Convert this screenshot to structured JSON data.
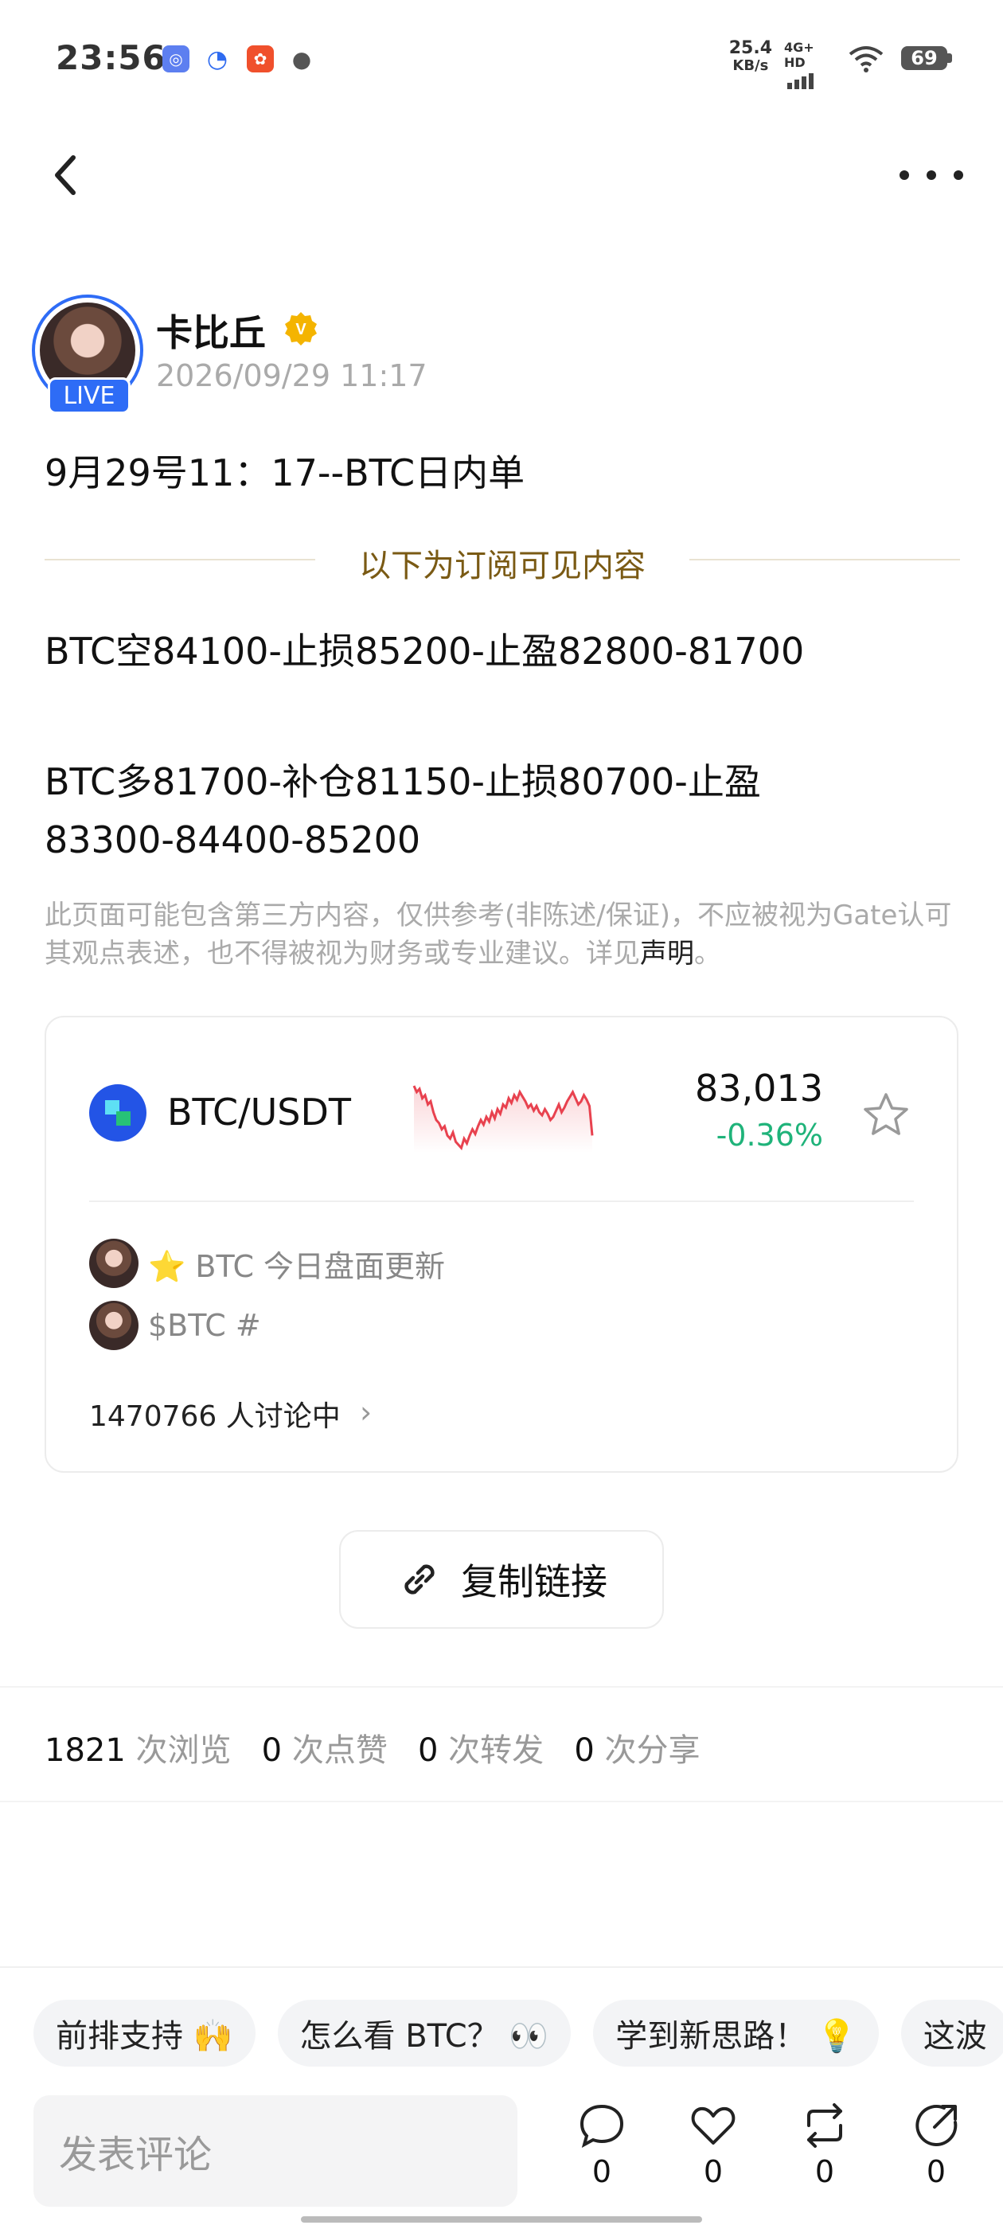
{
  "status_bar": {
    "time": "23:56",
    "net_speed_value": "25.4",
    "net_speed_unit": "KB/s",
    "network": "4G+ HD",
    "battery": "69"
  },
  "author": {
    "name": "卡比丘",
    "live_label": "LIVE",
    "timestamp": "2026/09/29 11:17"
  },
  "post": {
    "title": "9月29号11：17--BTC日内单",
    "subscribe_divider": "以下为订阅可见内容",
    "lines": [
      "BTC空84100-止损85200-止盈82800-81700",
      "BTC多81700-补仓81150-止损80700-止盈",
      "83300-84400-85200"
    ],
    "disclaimer_text": "此页面可能包含第三方内容，仅供参考(非陈述/保证)，不应被视为Gate认可其观点表述，也不得被视为财务或专业建议。详见",
    "disclaimer_link": "声明",
    "disclaimer_end": "。"
  },
  "market_card": {
    "pair": "BTC/USDT",
    "price": "83,013",
    "change": "-0.36%",
    "topics": [
      "⭐ BTC 今日盘面更新",
      "$BTC #"
    ],
    "discussion": "1470766 人讨论中",
    "sparkline": [
      52,
      48,
      50,
      44,
      46,
      40,
      42,
      35,
      30,
      28,
      24,
      26,
      20,
      18,
      22,
      16,
      14,
      12,
      18,
      15,
      20,
      24,
      21,
      26,
      30,
      27,
      32,
      29,
      35,
      31,
      37,
      34,
      40,
      38,
      44,
      41,
      46,
      43,
      48,
      45,
      42,
      38,
      40,
      36,
      39,
      35,
      33,
      37,
      34,
      30,
      32,
      36,
      40,
      35,
      38,
      42,
      45,
      48,
      44,
      40,
      42,
      46,
      43,
      39,
      20
    ]
  },
  "copy_link_label": "复制链接",
  "stats": [
    {
      "num": "1821",
      "label": "次浏览"
    },
    {
      "num": "0",
      "label": "次点赞"
    },
    {
      "num": "0",
      "label": "次转发"
    },
    {
      "num": "0",
      "label": "次分享"
    }
  ],
  "quick_replies": [
    "前排支持 🙌",
    "怎么看 BTC？ 👀",
    "学到新思路！ 💡",
    "这波"
  ],
  "comment_placeholder": "发表评论",
  "actions": [
    {
      "icon": "comment-icon",
      "count": "0"
    },
    {
      "icon": "like-icon",
      "count": "0"
    },
    {
      "icon": "repost-icon",
      "count": "0"
    },
    {
      "icon": "share-icon",
      "count": "0"
    }
  ],
  "colors": {
    "accent_blue": "#2e6cf6",
    "positive_green": "#1fb37a",
    "sparkline_red": "#e8424f",
    "divider_gold": "#7a5a14"
  }
}
